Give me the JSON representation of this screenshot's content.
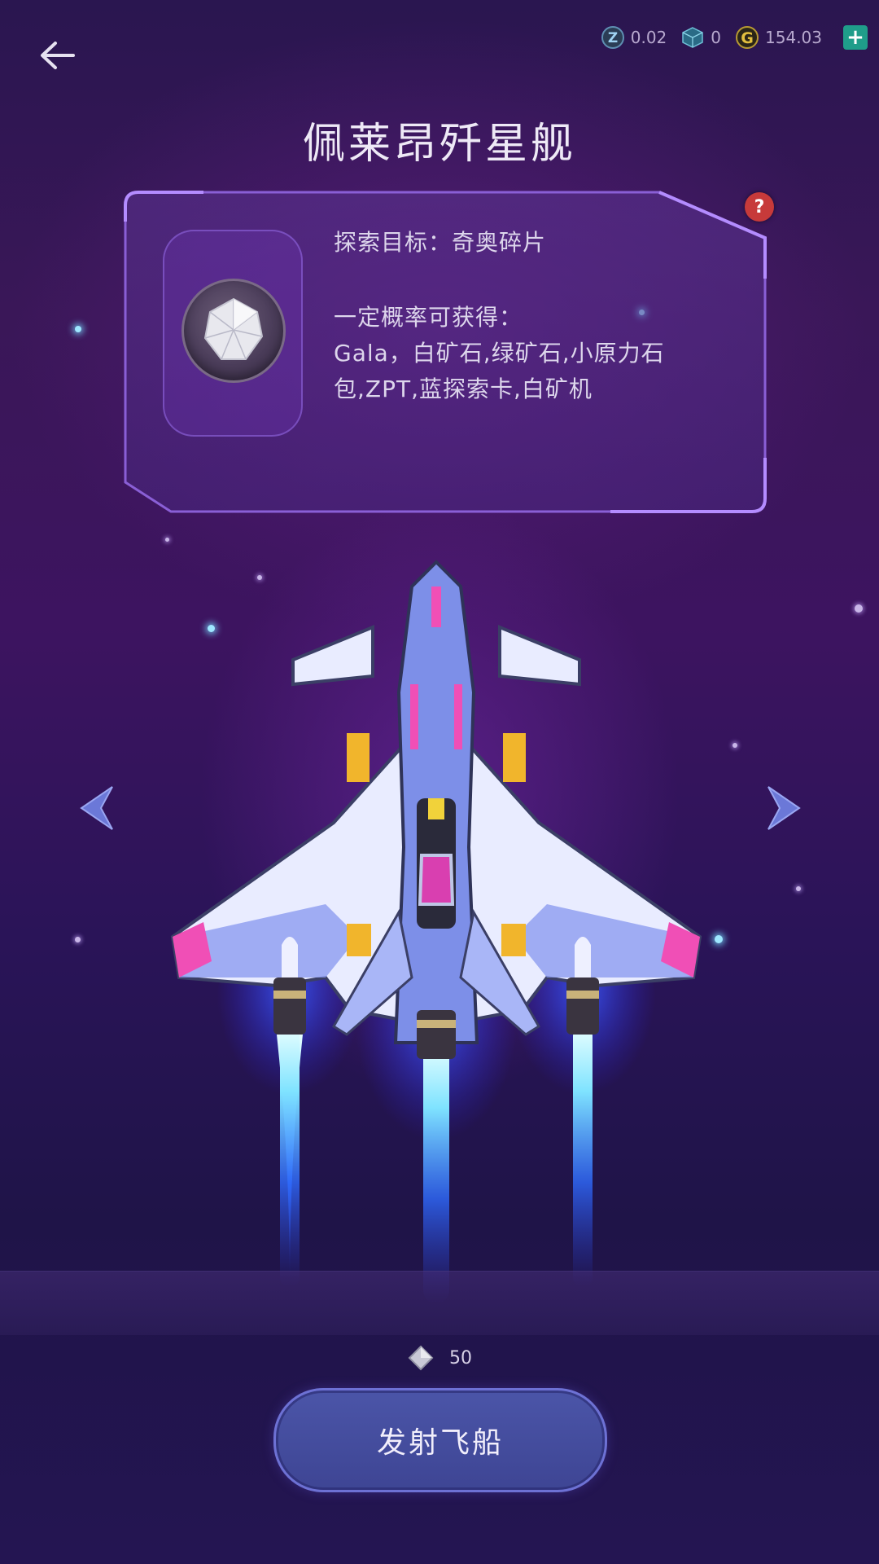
{
  "header": {
    "back_icon": "back-arrow-icon",
    "resources": [
      {
        "icon": "z-token-icon",
        "value": "0.02"
      },
      {
        "icon": "cube-icon",
        "value": "0"
      },
      {
        "icon": "gala-coin-icon",
        "value": "154.03"
      }
    ],
    "add_icon": "plus-icon"
  },
  "ship": {
    "name": "佩莱昂歼星舰"
  },
  "panel": {
    "help_label": "?",
    "target_line": "探索目标：奇奥碎片",
    "drop_title": "一定概率可获得：",
    "drop_line1": "Gala，白矿石,绿矿石,小原力石",
    "drop_line2": "包,ZPT,蓝探索卡,白矿机",
    "item_icon": "crystal-orb-icon"
  },
  "cost": {
    "icon": "diamond-icon",
    "value": "50"
  },
  "launch": {
    "label": "发射飞船"
  },
  "colors": {
    "accent": "#6d71d4",
    "button": "#4b55a8",
    "help": "#c73a3a",
    "plus": "#1f9d8a"
  }
}
